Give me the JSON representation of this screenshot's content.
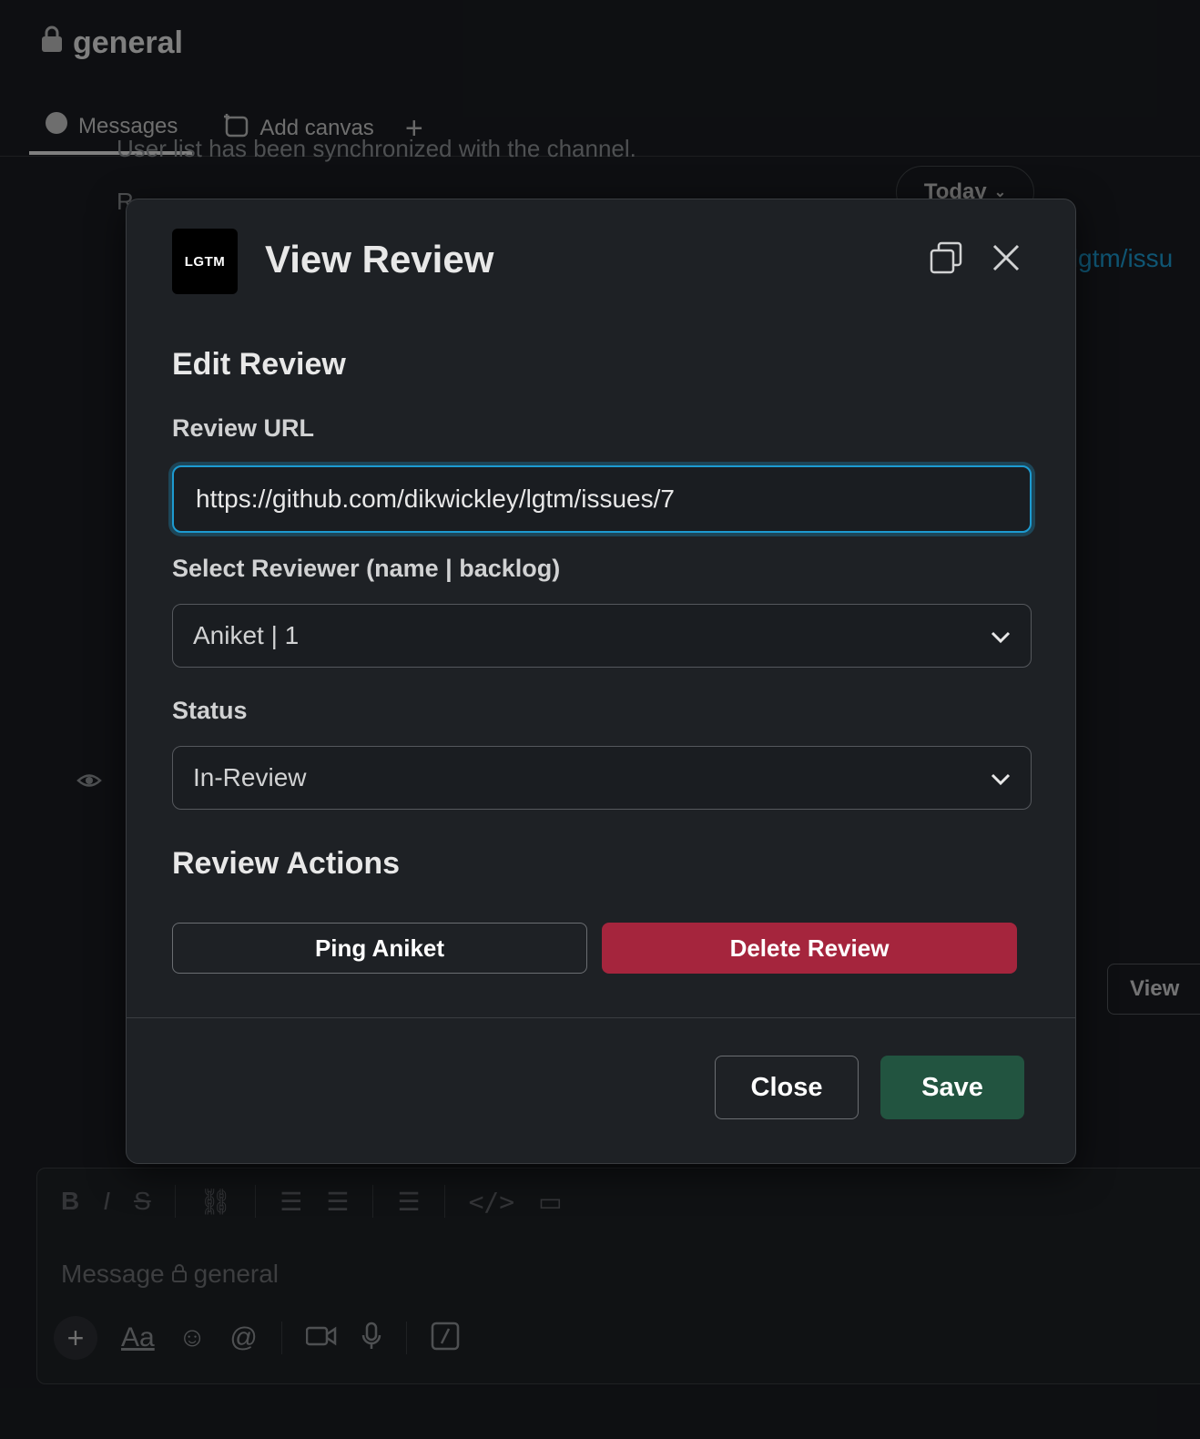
{
  "channel": {
    "name": "general",
    "tabs": [
      {
        "label": "Messages"
      },
      {
        "label": "Add canvas"
      }
    ]
  },
  "background": {
    "line1": "User list has been synchronized with the channel.",
    "line2": "R",
    "today_label": "Today",
    "link_text": "/lgtm/issu",
    "view_label": "View"
  },
  "composer": {
    "placeholder": "Message",
    "channel": "general"
  },
  "modal": {
    "logo_text": "LGTM",
    "title": "View Review",
    "section_edit": "Edit Review",
    "url_label": "Review URL",
    "url_value": "https://github.com/dikwickley/lgtm/issues/7",
    "reviewer_label": "Select Reviewer (name | backlog)",
    "reviewer_value": "Aniket | 1",
    "status_label": "Status",
    "status_value": "In-Review",
    "section_actions": "Review Actions",
    "ping_label": "Ping Aniket",
    "delete_label": "Delete Review",
    "close_label": "Close",
    "save_label": "Save"
  },
  "colors": {
    "accent": "#1d9bd1",
    "danger": "#a5253d",
    "save": "#225440"
  }
}
